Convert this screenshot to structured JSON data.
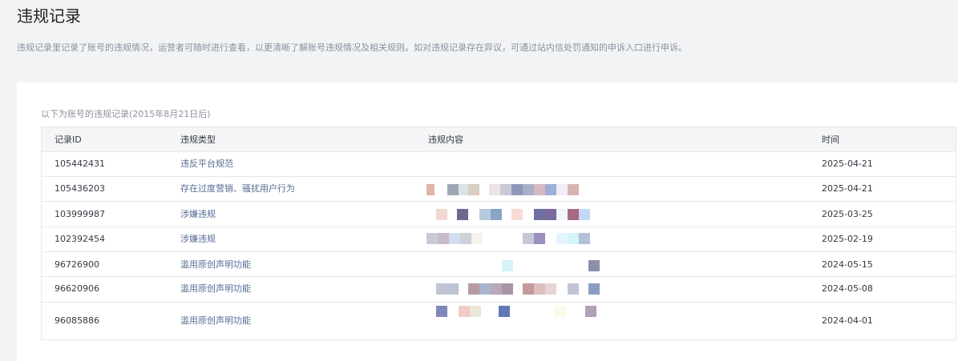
{
  "page": {
    "title": "违规记录",
    "description": "违规记录里记录了账号的违规情况，运营者可随时进行查看，以更清晰了解账号违规情况及相关规则。如对违规记录存在异议，可通过站内信处罚通知的申诉入口进行申诉。"
  },
  "table": {
    "caption": "以下为账号的违规记录(2015年8月21日后)",
    "headers": {
      "id": "记录ID",
      "type": "违规类型",
      "content": "违规内容",
      "time": "时间"
    },
    "rows": [
      {
        "id": "105442431",
        "type": "违反平台规范",
        "time": "2025-04-21"
      },
      {
        "id": "105436203",
        "type": "存在过度营销、骚扰用户行为",
        "time": "2025-04-21"
      },
      {
        "id": "103999987",
        "type": "涉嫌违规",
        "time": "2025-03-25"
      },
      {
        "id": "102392454",
        "type": "涉嫌违规",
        "time": "2025-02-19"
      },
      {
        "id": "96726900",
        "type": "滥用原创声明功能",
        "time": "2024-05-15"
      },
      {
        "id": "96620906",
        "type": "滥用原创声明功能",
        "time": "2024-05-08"
      },
      {
        "id": "96085886",
        "type": "滥用原创声明功能",
        "time": "2024-04-01"
      }
    ]
  },
  "colors": {
    "accent_link": "#576b95",
    "text_primary": "#353942",
    "text_secondary": "#8a919f",
    "header_bg": "#f4f5f7",
    "border": "#e7e8eb"
  }
}
